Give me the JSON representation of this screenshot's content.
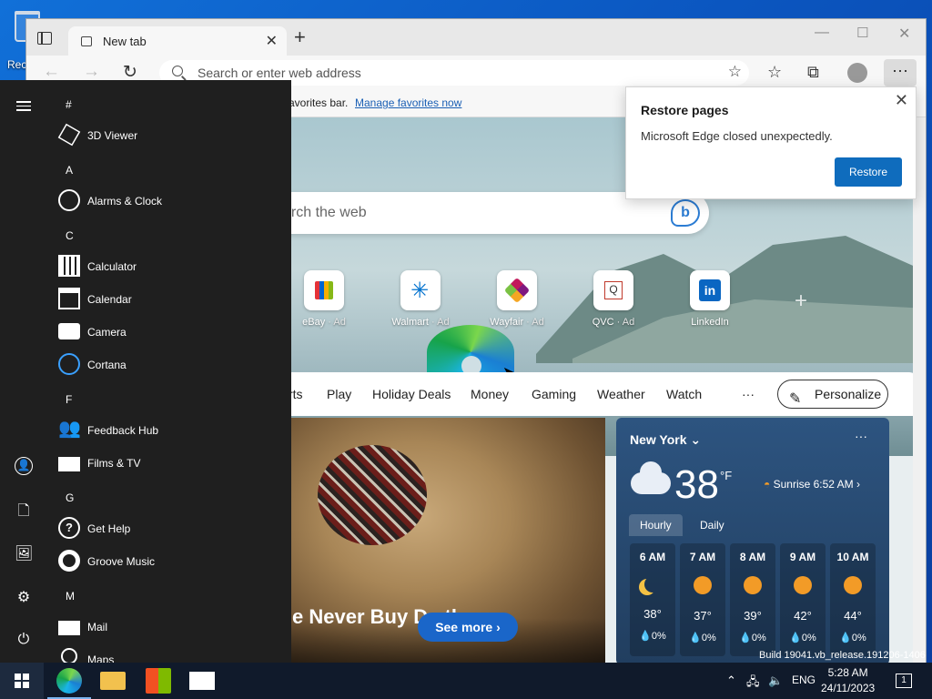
{
  "desktop": {
    "recycle_label": "Rec",
    "build_text": "Build 19041.vb_release.191206-1406"
  },
  "browser": {
    "tab_title": "New tab",
    "address_placeholder": "Search or enter web address",
    "favorites_bar_message": "avorites bar.",
    "favorites_bar_link": "Manage favorites now",
    "more_label": "···"
  },
  "restore_popup": {
    "title": "Restore pages",
    "message": "Microsoft Edge closed unexpectedly.",
    "button": "Restore"
  },
  "newtab": {
    "search_placeholder": "arch the web",
    "top_sites": [
      {
        "name": "eBay",
        "ad": "· Ad"
      },
      {
        "name": "Walmart",
        "ad": "· Ad"
      },
      {
        "name": "Wayfair",
        "ad": "· Ad"
      },
      {
        "name": "QVC",
        "ad": "· Ad"
      },
      {
        "name": "LinkedIn",
        "ad": ""
      }
    ],
    "categories": [
      "rts",
      "Play",
      "Holiday Deals",
      "Money",
      "Gaming",
      "Weather",
      "Watch",
      "···"
    ],
    "personalize": "Personalize",
    "hero_title": "e Never Buy D...the",
    "see_more": "See more",
    "weather": {
      "city": "New York",
      "temp": "38",
      "unit": "°F",
      "sunrise": "Sunrise 6:52 AM",
      "tabs": [
        "Hourly",
        "Daily"
      ],
      "hours": [
        {
          "time": "6 AM",
          "temp": "38°",
          "precip": "💧0%",
          "icon": "moon"
        },
        {
          "time": "7 AM",
          "temp": "37°",
          "precip": "💧0%",
          "icon": "sun"
        },
        {
          "time": "8 AM",
          "temp": "39°",
          "precip": "💧0%",
          "icon": "sun"
        },
        {
          "time": "9 AM",
          "temp": "42°",
          "precip": "💧0%",
          "icon": "sun"
        },
        {
          "time": "10 AM",
          "temp": "44°",
          "precip": "💧0%",
          "icon": "sun"
        }
      ]
    }
  },
  "start_menu": {
    "sections": [
      {
        "letter": "#",
        "apps": [
          "3D Viewer"
        ]
      },
      {
        "letter": "A",
        "apps": [
          "Alarms & Clock"
        ]
      },
      {
        "letter": "C",
        "apps": [
          "Calculator",
          "Calendar",
          "Camera",
          "Cortana"
        ]
      },
      {
        "letter": "F",
        "apps": [
          "Feedback Hub",
          "Films & TV"
        ]
      },
      {
        "letter": "G",
        "apps": [
          "Get Help",
          "Groove Music"
        ]
      },
      {
        "letter": "M",
        "apps": [
          "Mail",
          "Maps"
        ]
      }
    ]
  },
  "taskbar": {
    "language": "ENG",
    "time": "5:28 AM",
    "date": "24/11/2023",
    "notification_count": "1"
  }
}
